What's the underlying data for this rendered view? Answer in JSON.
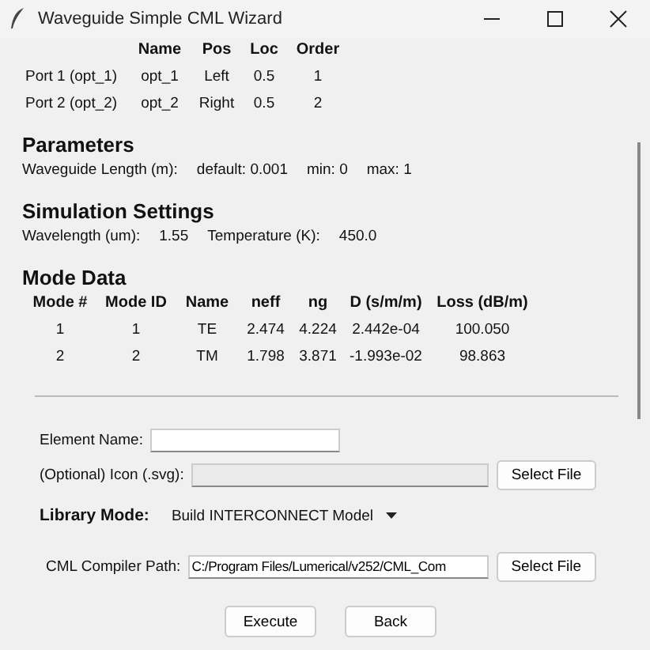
{
  "window": {
    "title": "Waveguide Simple CML Wizard"
  },
  "ports": {
    "columns": [
      "",
      "Name",
      "Pos",
      "Loc",
      "Order"
    ],
    "rows": [
      [
        "Port 1 (opt_1)",
        "opt_1",
        "Left",
        "0.5",
        "1"
      ],
      [
        "Port 2 (opt_2)",
        "opt_2",
        "Right",
        "0.5",
        "2"
      ]
    ]
  },
  "parameters": {
    "heading": "Parameters",
    "items": [
      "Waveguide Length (m):",
      "default: 0.001",
      "min: 0",
      "max: 1"
    ]
  },
  "simulation": {
    "heading": "Simulation Settings",
    "items": [
      "Wavelength (um):",
      "1.55",
      "Temperature (K):",
      "450.0"
    ]
  },
  "modes": {
    "heading": "Mode Data",
    "columns": [
      "Mode #",
      "Mode ID",
      "Name",
      "neff",
      "ng",
      "D (s/m/m)",
      "Loss (dB/m)"
    ],
    "rows": [
      [
        "1",
        "1",
        "TE",
        "2.474",
        "4.224",
        "2.442e-04",
        "100.050"
      ],
      [
        "2",
        "2",
        "TM",
        "1.798",
        "3.871",
        "-1.993e-02",
        "98.863"
      ]
    ]
  },
  "form": {
    "element_name": {
      "label": "Element Name:"
    },
    "icon": {
      "label": "(Optional) Icon (.svg):",
      "button": "Select File",
      "disabled": true
    },
    "library_mode": {
      "label": "Library Mode:",
      "value": "Build INTERCONNECT Model"
    },
    "compiler": {
      "label": "CML Compiler Path:",
      "value": "C:/Program Files/Lumerical/v252/CML_Com",
      "button": "Select File"
    }
  },
  "buttons": [
    "Execute",
    "Back"
  ]
}
